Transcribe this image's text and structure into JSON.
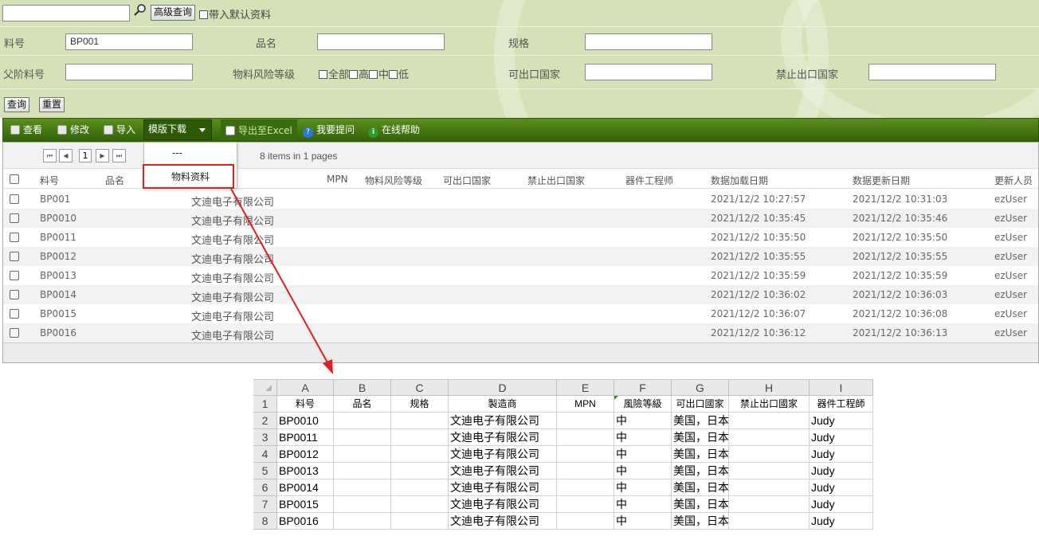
{
  "search": {
    "keyword_value": "",
    "advanced_button": "高级查询",
    "include_default_label": "带入默认资料",
    "part_no_label": "料号",
    "part_no_value": "BP001",
    "name_label": "品名",
    "spec_label": "规格",
    "parent_part_label": "父阶料号",
    "risk_level_label": "物料风险等级",
    "risk_options": [
      "全部",
      "高",
      "中",
      "低"
    ],
    "export_countries_label": "可出口国家",
    "forbidden_countries_label": "禁止出口国家",
    "query_button": "查询",
    "reset_button": "重置"
  },
  "toolbar": {
    "view": "查看",
    "edit": "修改",
    "import": "导入",
    "template_download": "模版下载",
    "export_excel": "导出至Excel",
    "ask_question": "我要提问",
    "online_help": "在线帮助"
  },
  "template_menu": [
    "---",
    "物料资料"
  ],
  "pager": {
    "current_page": "1",
    "summary": "8 items in 1 pages"
  },
  "grid": {
    "columns": {
      "part_no": "料号",
      "name": "品名",
      "mpn": "MPN",
      "risk": "物料风险等级",
      "export": "可出口国家",
      "forbidden": "禁止出口国家",
      "engineer": "器件工程师",
      "load_date": "数据加载日期",
      "update_date": "数据更新日期",
      "updater": "更新人员"
    },
    "rows": [
      {
        "part_no": "BP001",
        "maker": "文迪电子有限公司",
        "load_date": "2021/12/2 10:27:57",
        "update_date": "2021/12/2 10:31:03",
        "updater": "ezUser"
      },
      {
        "part_no": "BP0010",
        "maker": "文迪电子有限公司",
        "load_date": "2021/12/2 10:35:45",
        "update_date": "2021/12/2 10:35:46",
        "updater": "ezUser"
      },
      {
        "part_no": "BP0011",
        "maker": "文迪电子有限公司",
        "load_date": "2021/12/2 10:35:50",
        "update_date": "2021/12/2 10:35:50",
        "updater": "ezUser"
      },
      {
        "part_no": "BP0012",
        "maker": "文迪电子有限公司",
        "load_date": "2021/12/2 10:35:55",
        "update_date": "2021/12/2 10:35:55",
        "updater": "ezUser"
      },
      {
        "part_no": "BP0013",
        "maker": "文迪电子有限公司",
        "load_date": "2021/12/2 10:35:59",
        "update_date": "2021/12/2 10:35:59",
        "updater": "ezUser"
      },
      {
        "part_no": "BP0014",
        "maker": "文迪电子有限公司",
        "load_date": "2021/12/2 10:36:02",
        "update_date": "2021/12/2 10:36:03",
        "updater": "ezUser"
      },
      {
        "part_no": "BP0015",
        "maker": "文迪电子有限公司",
        "load_date": "2021/12/2 10:36:07",
        "update_date": "2021/12/2 10:36:08",
        "updater": "ezUser"
      },
      {
        "part_no": "BP0016",
        "maker": "文迪电子有限公司",
        "load_date": "2021/12/2 10:36:12",
        "update_date": "2021/12/2 10:36:13",
        "updater": "ezUser"
      }
    ]
  },
  "excel": {
    "col_letters": [
      "A",
      "B",
      "C",
      "D",
      "E",
      "F",
      "G",
      "H",
      "I"
    ],
    "headers": [
      "料号",
      "品名",
      "规格",
      "製造商",
      "MPN",
      "風險等級",
      "可出口國家",
      "禁止出口國家",
      "器件工程師"
    ],
    "rows": [
      {
        "num": "2",
        "cells": [
          "BP0010",
          "",
          "",
          "文迪电子有限公司",
          "",
          "中",
          "美国，日本",
          "",
          "Judy"
        ]
      },
      {
        "num": "3",
        "cells": [
          "BP0011",
          "",
          "",
          "文迪电子有限公司",
          "",
          "中",
          "美国，日本",
          "",
          "Judy"
        ]
      },
      {
        "num": "4",
        "cells": [
          "BP0012",
          "",
          "",
          "文迪电子有限公司",
          "",
          "中",
          "美国，日本",
          "",
          "Judy"
        ]
      },
      {
        "num": "5",
        "cells": [
          "BP0013",
          "",
          "",
          "文迪电子有限公司",
          "",
          "中",
          "美国，日本",
          "",
          "Judy"
        ]
      },
      {
        "num": "6",
        "cells": [
          "BP0014",
          "",
          "",
          "文迪电子有限公司",
          "",
          "中",
          "美国，日本",
          "",
          "Judy"
        ]
      },
      {
        "num": "7",
        "cells": [
          "BP0015",
          "",
          "",
          "文迪电子有限公司",
          "",
          "中",
          "美国，日本",
          "",
          "Judy"
        ]
      },
      {
        "num": "8",
        "cells": [
          "BP0016",
          "",
          "",
          "文迪电子有限公司",
          "",
          "中",
          "美国，日本",
          "",
          "Judy"
        ]
      }
    ]
  },
  "colors": {
    "panel_bg": "#d5e1b6",
    "toolbar": "#4a7a14",
    "highlight": "#d9241c"
  }
}
